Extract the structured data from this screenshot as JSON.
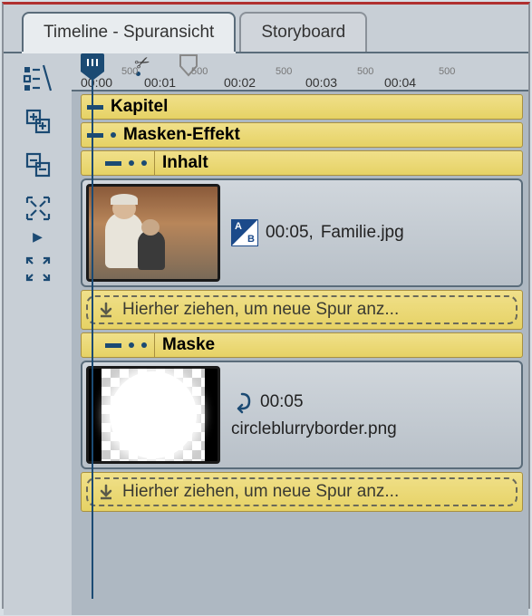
{
  "tabs": {
    "timeline": "Timeline - Spuransicht",
    "storyboard": "Storyboard"
  },
  "ruler": {
    "ticks_major": [
      "00:00",
      "00:01",
      "00:02",
      "00:03",
      "00:04"
    ],
    "ticks_minor": [
      "500",
      "500",
      "500",
      "500",
      "500"
    ]
  },
  "tracks": {
    "chapter": {
      "title": "Kapitel"
    },
    "mask_effect": {
      "title": "Masken-Effekt"
    },
    "content": {
      "title": "Inhalt",
      "clip": {
        "duration": "00:05,",
        "filename": "Familie.jpg"
      },
      "dropzone": "Hierher ziehen, um neue Spur anz..."
    },
    "mask": {
      "title": "Maske",
      "clip": {
        "duration": "00:05",
        "filename": "circleblurryborder.png"
      },
      "dropzone": "Hierher ziehen, um neue Spur anz..."
    }
  }
}
